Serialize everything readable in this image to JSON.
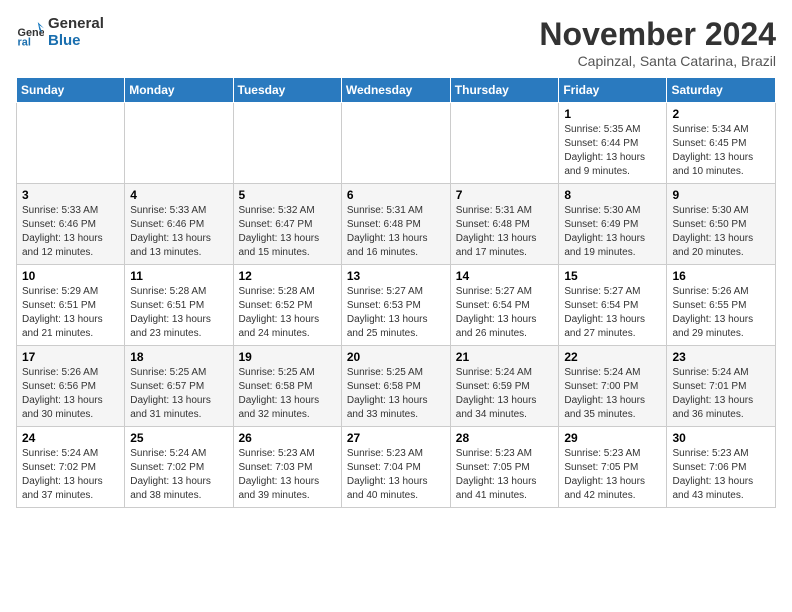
{
  "logo": {
    "line1": "General",
    "line2": "Blue"
  },
  "title": "November 2024",
  "subtitle": "Capinzal, Santa Catarina, Brazil",
  "days_of_week": [
    "Sunday",
    "Monday",
    "Tuesday",
    "Wednesday",
    "Thursday",
    "Friday",
    "Saturday"
  ],
  "weeks": [
    [
      {
        "day": "",
        "info": ""
      },
      {
        "day": "",
        "info": ""
      },
      {
        "day": "",
        "info": ""
      },
      {
        "day": "",
        "info": ""
      },
      {
        "day": "",
        "info": ""
      },
      {
        "day": "1",
        "info": "Sunrise: 5:35 AM\nSunset: 6:44 PM\nDaylight: 13 hours\nand 9 minutes."
      },
      {
        "day": "2",
        "info": "Sunrise: 5:34 AM\nSunset: 6:45 PM\nDaylight: 13 hours\nand 10 minutes."
      }
    ],
    [
      {
        "day": "3",
        "info": "Sunrise: 5:33 AM\nSunset: 6:46 PM\nDaylight: 13 hours\nand 12 minutes."
      },
      {
        "day": "4",
        "info": "Sunrise: 5:33 AM\nSunset: 6:46 PM\nDaylight: 13 hours\nand 13 minutes."
      },
      {
        "day": "5",
        "info": "Sunrise: 5:32 AM\nSunset: 6:47 PM\nDaylight: 13 hours\nand 15 minutes."
      },
      {
        "day": "6",
        "info": "Sunrise: 5:31 AM\nSunset: 6:48 PM\nDaylight: 13 hours\nand 16 minutes."
      },
      {
        "day": "7",
        "info": "Sunrise: 5:31 AM\nSunset: 6:48 PM\nDaylight: 13 hours\nand 17 minutes."
      },
      {
        "day": "8",
        "info": "Sunrise: 5:30 AM\nSunset: 6:49 PM\nDaylight: 13 hours\nand 19 minutes."
      },
      {
        "day": "9",
        "info": "Sunrise: 5:30 AM\nSunset: 6:50 PM\nDaylight: 13 hours\nand 20 minutes."
      }
    ],
    [
      {
        "day": "10",
        "info": "Sunrise: 5:29 AM\nSunset: 6:51 PM\nDaylight: 13 hours\nand 21 minutes."
      },
      {
        "day": "11",
        "info": "Sunrise: 5:28 AM\nSunset: 6:51 PM\nDaylight: 13 hours\nand 23 minutes."
      },
      {
        "day": "12",
        "info": "Sunrise: 5:28 AM\nSunset: 6:52 PM\nDaylight: 13 hours\nand 24 minutes."
      },
      {
        "day": "13",
        "info": "Sunrise: 5:27 AM\nSunset: 6:53 PM\nDaylight: 13 hours\nand 25 minutes."
      },
      {
        "day": "14",
        "info": "Sunrise: 5:27 AM\nSunset: 6:54 PM\nDaylight: 13 hours\nand 26 minutes."
      },
      {
        "day": "15",
        "info": "Sunrise: 5:27 AM\nSunset: 6:54 PM\nDaylight: 13 hours\nand 27 minutes."
      },
      {
        "day": "16",
        "info": "Sunrise: 5:26 AM\nSunset: 6:55 PM\nDaylight: 13 hours\nand 29 minutes."
      }
    ],
    [
      {
        "day": "17",
        "info": "Sunrise: 5:26 AM\nSunset: 6:56 PM\nDaylight: 13 hours\nand 30 minutes."
      },
      {
        "day": "18",
        "info": "Sunrise: 5:25 AM\nSunset: 6:57 PM\nDaylight: 13 hours\nand 31 minutes."
      },
      {
        "day": "19",
        "info": "Sunrise: 5:25 AM\nSunset: 6:58 PM\nDaylight: 13 hours\nand 32 minutes."
      },
      {
        "day": "20",
        "info": "Sunrise: 5:25 AM\nSunset: 6:58 PM\nDaylight: 13 hours\nand 33 minutes."
      },
      {
        "day": "21",
        "info": "Sunrise: 5:24 AM\nSunset: 6:59 PM\nDaylight: 13 hours\nand 34 minutes."
      },
      {
        "day": "22",
        "info": "Sunrise: 5:24 AM\nSunset: 7:00 PM\nDaylight: 13 hours\nand 35 minutes."
      },
      {
        "day": "23",
        "info": "Sunrise: 5:24 AM\nSunset: 7:01 PM\nDaylight: 13 hours\nand 36 minutes."
      }
    ],
    [
      {
        "day": "24",
        "info": "Sunrise: 5:24 AM\nSunset: 7:02 PM\nDaylight: 13 hours\nand 37 minutes."
      },
      {
        "day": "25",
        "info": "Sunrise: 5:24 AM\nSunset: 7:02 PM\nDaylight: 13 hours\nand 38 minutes."
      },
      {
        "day": "26",
        "info": "Sunrise: 5:23 AM\nSunset: 7:03 PM\nDaylight: 13 hours\nand 39 minutes."
      },
      {
        "day": "27",
        "info": "Sunrise: 5:23 AM\nSunset: 7:04 PM\nDaylight: 13 hours\nand 40 minutes."
      },
      {
        "day": "28",
        "info": "Sunrise: 5:23 AM\nSunset: 7:05 PM\nDaylight: 13 hours\nand 41 minutes."
      },
      {
        "day": "29",
        "info": "Sunrise: 5:23 AM\nSunset: 7:05 PM\nDaylight: 13 hours\nand 42 minutes."
      },
      {
        "day": "30",
        "info": "Sunrise: 5:23 AM\nSunset: 7:06 PM\nDaylight: 13 hours\nand 43 minutes."
      }
    ]
  ]
}
